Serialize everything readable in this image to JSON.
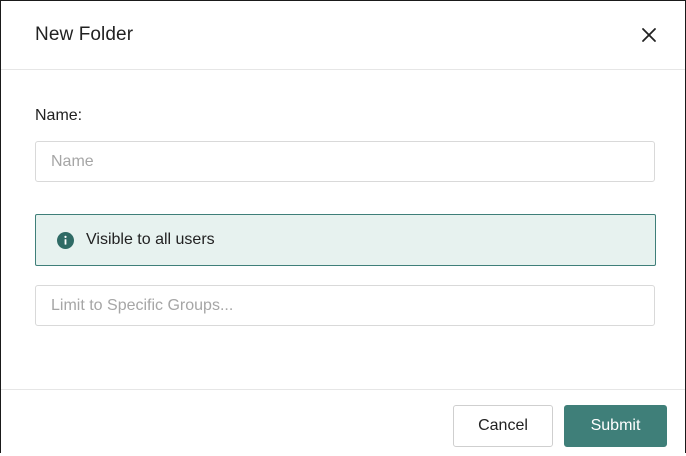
{
  "dialog": {
    "title": "New Folder",
    "close_icon": "close-icon"
  },
  "form": {
    "name_label": "Name:",
    "name_value": "",
    "name_placeholder": "Name",
    "visibility_icon": "info-icon",
    "visibility_text": "Visible to all users",
    "groups_value": "",
    "groups_placeholder": "Limit to Specific Groups..."
  },
  "footer": {
    "cancel_label": "Cancel",
    "submit_label": "Submit"
  },
  "colors": {
    "accent": "#3f7f79",
    "info_background": "#e7f2ef",
    "text": "#222222",
    "placeholder": "#a6a6a6",
    "border": "#d9d9d9"
  }
}
